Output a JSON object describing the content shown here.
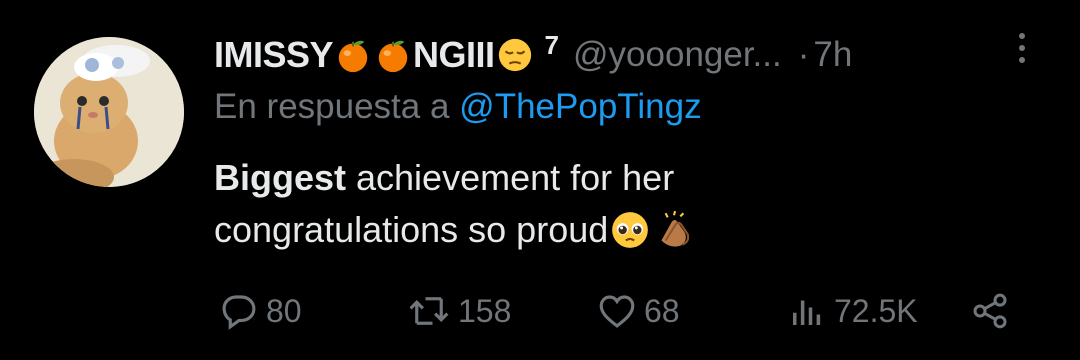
{
  "tweet": {
    "display_name": "IMISSY",
    "display_name_mid": "NGIII",
    "badge": "7",
    "handle": "@yooonger...",
    "dot": "·",
    "time": "7h",
    "reply_prefix": "En respuesta a",
    "reply_to": "@ThePopTingz",
    "body_bold": "Biggest",
    "body_line1_rest": " achievement for her",
    "body_line2": "congratulations so proud"
  },
  "actions": {
    "replies": "80",
    "retweets": "158",
    "likes": "68",
    "views": "72.5K"
  },
  "colors": {
    "background": "#000000",
    "text": "#e7e9ea",
    "muted": "#71767b",
    "link": "#1d9bf0"
  }
}
